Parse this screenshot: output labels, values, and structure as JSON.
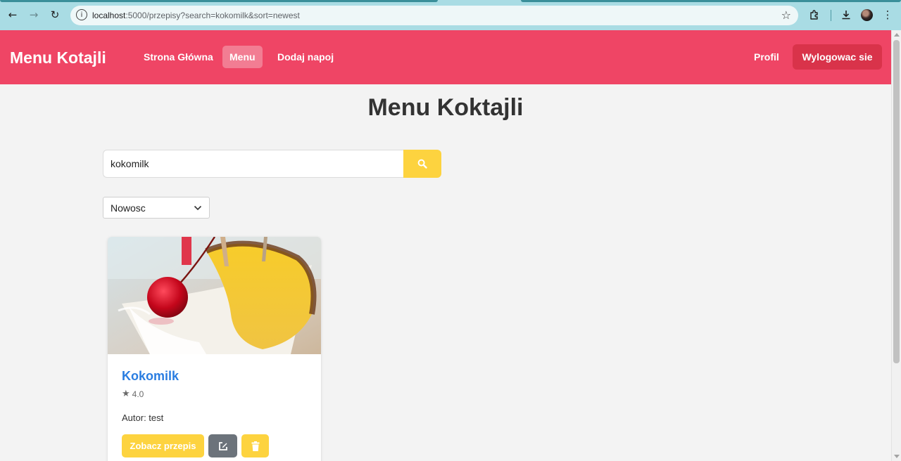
{
  "browser": {
    "url_host": "localhost",
    "url_rest": ":5000/przepisy?search=kokomilk&sort=newest",
    "icons": {
      "back": "arrow-left-icon",
      "forward": "arrow-right-icon",
      "reload": "reload-icon",
      "site_info": "info-icon",
      "bookmark": "star-outline-icon",
      "extensions": "puzzle-icon",
      "download": "download-icon",
      "profile": "avatar",
      "menu": "kebab-menu-icon"
    }
  },
  "header": {
    "brand": "Menu Kotajli",
    "nav": [
      {
        "label": "Strona Główna",
        "active": false
      },
      {
        "label": "Menu",
        "active": true
      },
      {
        "label": "Dodaj napoj",
        "active": false
      }
    ],
    "profile_label": "Profil",
    "logout_label": "Wylogowac sie",
    "colors": {
      "bar": "#ef4565",
      "active_tab": "#f27d93",
      "logout": "#d9334a"
    }
  },
  "main": {
    "title": "Menu Koktajli",
    "search": {
      "value": "kokomilk",
      "button_icon": "search-icon"
    },
    "sort": {
      "selected": "Nowosc"
    }
  },
  "cards": [
    {
      "title": "Kokomilk",
      "rating": "4.0",
      "author": "Autor: test",
      "view_label": "Zobacz przepis",
      "edit_icon": "edit-icon",
      "delete_icon": "trash-icon",
      "image": "pina-colada-photo"
    }
  ],
  "colors": {
    "accent_yellow": "#fdd33f",
    "link_blue": "#2a7de1",
    "edit_gray": "#6c737b"
  }
}
